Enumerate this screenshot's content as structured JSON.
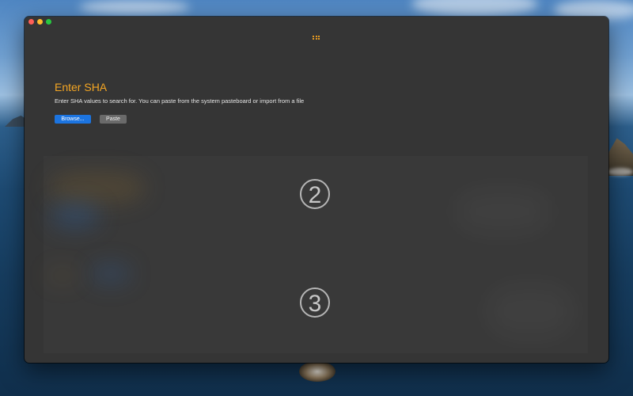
{
  "window": {
    "traffic_lights": [
      "close",
      "minimize",
      "zoom"
    ]
  },
  "toolbar": {
    "icon": "grid-icon"
  },
  "content": {
    "title": "Enter SHA",
    "description": "Enter SHA values to search for. You can paste from the system pasteboard or import from a file",
    "browse_label": "Browse...",
    "paste_label": "Paste"
  },
  "steps": {
    "step2": "2",
    "step3": "3"
  },
  "colors": {
    "accent": "#f5a623",
    "primary_button": "#1c74e0",
    "secondary_button": "#6a6a6a",
    "window_bg": "#353535"
  }
}
